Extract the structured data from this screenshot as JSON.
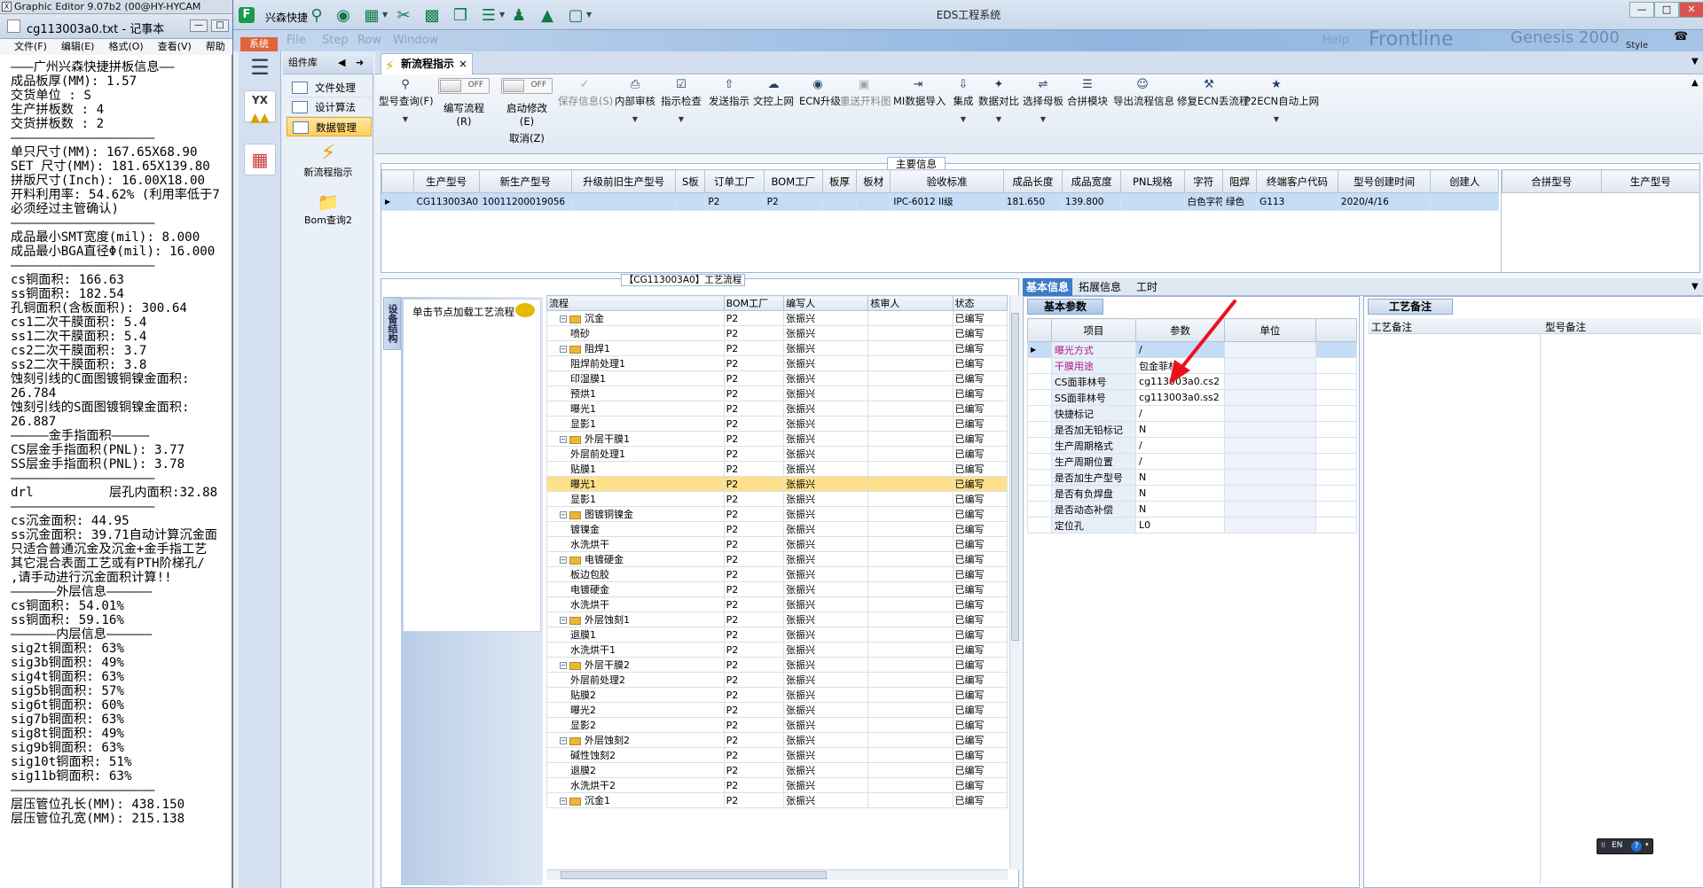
{
  "ge_window": {
    "title": "Graphic Editor 9.07b2 (00@HY-HYCAM"
  },
  "notepad": {
    "title": "cg113003a0.txt - 记事本",
    "menu": [
      "文件(F)",
      "编辑(E)",
      "格式(O)",
      "查看(V)",
      "帮助"
    ],
    "lines": [
      "———广州兴森快捷拼板信息——",
      "成品板厚(MM): 1.57",
      "交货单位 : S",
      "生产拼板数 : 4",
      "交货拼板数 : 2",
      "———————————————————",
      "单只尺寸(MM): 167.65X68.90",
      "SET 尺寸(MM): 181.65X139.80",
      "拼版尺寸(Inch): 16.00X18.00",
      "开料利用率: 54.62% (利用率低于7",
      "必须经过主管确认)",
      "———————————————————",
      "成品最小SMT宽度(mil): 8.000",
      "成品最小BGA直径Φ(mil): 16.000",
      "———————————————————",
      "cs铜面积: 166.63",
      "ss铜面积: 182.54",
      "孔铜面积(含板面积): 300.64",
      "",
      "cs1二次干膜面积: 5.4",
      "ss1二次干膜面积: 5.4",
      "cs2二次干膜面积: 3.7",
      "ss2二次干膜面积: 3.8",
      "蚀刻引线的C面图镀铜镍金面积:",
      "26.784",
      "蚀刻引线的S面图镀铜镍金面积:",
      "26.887",
      "—————金手指面积—————",
      "CS层金手指面积(PNL): 3.77",
      "SS层金手指面积(PNL): 3.78",
      "———————————————————",
      "drl          层孔内面积:32.88",
      "———————————————————",
      "",
      "cs沉金面积: 44.95",
      "ss沉金面积: 39.71自动计算沉金面",
      "只适合普通沉金及沉金+金手指工艺",
      "其它混合表面工艺或有PTH阶梯孔/",
      ",请手动进行沉金面积计算!!",
      "——————外层信息——————",
      "cs铜面积: 54.01%",
      "ss铜面积: 59.16%",
      "——————内层信息——————",
      "sig2t铜面积: 63%",
      "sig3b铜面积: 49%",
      "sig4t铜面积: 63%",
      "sig5b铜面积: 57%",
      "sig6t铜面积: 60%",
      "sig7b铜面积: 63%",
      "sig8t铜面积: 49%",
      "sig9b铜面积: 63%",
      "sig10t铜面积: 51%",
      "sig11b铜面积: 63%",
      "———————————————————",
      "层压管位孔长(MM): 438.150",
      "层压管位孔宽(MM): 215.138"
    ]
  },
  "app": {
    "title": "EDS工程系统",
    "quick_label": "兴森快捷",
    "system_tab": "系统",
    "style_label": "Style",
    "blur_text": [
      "File",
      "Step",
      "Row",
      "Window",
      "Help",
      "Frontline",
      "Genesis 2000"
    ],
    "window_buttons": [
      "—",
      "□",
      "✕"
    ]
  },
  "component_lib": {
    "title": "组件库",
    "items": [
      "文件处理",
      "设计算法",
      "数据管理"
    ],
    "big_items": [
      "新流程指示",
      "Bom查询2"
    ]
  },
  "doc_tab": {
    "label": "新流程指示",
    "close": "×"
  },
  "ribbon": {
    "buttons": [
      {
        "label": "型号查询(F)",
        "icon": "magnifier-icon",
        "dropdown": true
      },
      {
        "label": "保存信息(S)",
        "icon": "check-icon",
        "disabled": true
      },
      {
        "label": "内部审核",
        "icon": "printer-icon",
        "dropdown": true
      },
      {
        "label": "指示检查",
        "icon": "checkbox-icon",
        "dropdown": true
      },
      {
        "label": "发送指示",
        "icon": "upload-icon"
      },
      {
        "label": "文控上网",
        "icon": "cloud-icon"
      },
      {
        "label": "ECN升级",
        "icon": "binoculars-icon"
      },
      {
        "label": "重送开料图",
        "icon": "picture-icon",
        "disabled": true
      },
      {
        "label": "MI数据导入",
        "icon": "import-icon"
      },
      {
        "label": "集成",
        "icon": "download-icon",
        "dropdown": true
      },
      {
        "label": "数据对比",
        "icon": "wand-icon",
        "dropdown": true
      },
      {
        "label": "选择母板",
        "icon": "shuffle-icon",
        "dropdown": true
      },
      {
        "label": "合拼模块",
        "icon": "list-icon"
      },
      {
        "label": "导出流程信息",
        "icon": "smile-icon"
      },
      {
        "label": "修复ECN丢流程",
        "icon": "wrench-icon"
      },
      {
        "label": "P2ECN自动上网",
        "icon": "star-icon",
        "dropdown": true
      }
    ],
    "toggle1": {
      "label": "编写流程(R)",
      "state": "OFF"
    },
    "toggle2": {
      "label": "启动修改(E)",
      "state": "OFF",
      "sub": "取消(Z)"
    }
  },
  "main_info": {
    "title": "主要信息",
    "columns": [
      "生产型号",
      "新生产型号",
      "升级前旧生产型号",
      "S板",
      "订单工厂",
      "BOM工厂",
      "板厚",
      "板材",
      "验收标准",
      "成品长度",
      "成品宽度",
      "PNL规格",
      "字符",
      "阻焊",
      "终端客户代码",
      "型号创建时间",
      "创建人"
    ],
    "row": [
      "CG113003A0",
      "10011200019056",
      "",
      "",
      "P2",
      "P2",
      "",
      "",
      "IPC-6012 II级",
      "181.650",
      "139.800",
      "",
      "白色字符",
      "绿色",
      "G113",
      "2020/4/16",
      ""
    ],
    "side_columns": [
      "合拼型号",
      "生产型号"
    ]
  },
  "flow": {
    "title": "【CG113003A0】工艺流程",
    "vtab": "设备结构",
    "hint": "单击节点加载工艺流程",
    "columns": [
      "流程",
      "BOM工厂",
      "编写人",
      "核审人",
      "状态"
    ],
    "rows": [
      {
        "name": "沉金",
        "level": 0,
        "factory": "P2",
        "writer": "张振兴",
        "status": "已编写"
      },
      {
        "name": "喷砂",
        "level": 1,
        "factory": "P2",
        "writer": "张振兴",
        "status": "已编写"
      },
      {
        "name": "阻焊1",
        "level": 0,
        "factory": "P2",
        "writer": "张振兴",
        "status": "已编写"
      },
      {
        "name": "阻焊前处理1",
        "level": 1,
        "factory": "P2",
        "writer": "张振兴",
        "status": "已编写"
      },
      {
        "name": "印湿膜1",
        "level": 1,
        "factory": "P2",
        "writer": "张振兴",
        "status": "已编写"
      },
      {
        "name": "预烘1",
        "level": 1,
        "factory": "P2",
        "writer": "张振兴",
        "status": "已编写"
      },
      {
        "name": "曝光1",
        "level": 1,
        "factory": "P2",
        "writer": "张振兴",
        "status": "已编写"
      },
      {
        "name": "显影1",
        "level": 1,
        "factory": "P2",
        "writer": "张振兴",
        "status": "已编写"
      },
      {
        "name": "外层干膜1",
        "level": 0,
        "factory": "P2",
        "writer": "张振兴",
        "status": "已编写"
      },
      {
        "name": "外层前处理1",
        "level": 1,
        "factory": "P2",
        "writer": "张振兴",
        "status": "已编写"
      },
      {
        "name": "贴膜1",
        "level": 1,
        "factory": "P2",
        "writer": "张振兴",
        "status": "已编写"
      },
      {
        "name": "曝光1",
        "level": 1,
        "factory": "P2",
        "writer": "张振兴",
        "status": "已编写",
        "selected": true
      },
      {
        "name": "显影1",
        "level": 1,
        "factory": "P2",
        "writer": "张振兴",
        "status": "已编写"
      },
      {
        "name": "图镀铜镍金",
        "level": 0,
        "factory": "P2",
        "writer": "张振兴",
        "status": "已编写"
      },
      {
        "name": "镀镍金",
        "level": 1,
        "factory": "P2",
        "writer": "张振兴",
        "status": "已编写"
      },
      {
        "name": "水洗烘干",
        "level": 1,
        "factory": "P2",
        "writer": "张振兴",
        "status": "已编写"
      },
      {
        "name": "电镀硬金",
        "level": 0,
        "factory": "P2",
        "writer": "张振兴",
        "status": "已编写"
      },
      {
        "name": "板边包胶",
        "level": 1,
        "factory": "P2",
        "writer": "张振兴",
        "status": "已编写"
      },
      {
        "name": "电镀硬金",
        "level": 1,
        "factory": "P2",
        "writer": "张振兴",
        "status": "已编写"
      },
      {
        "name": "水洗烘干",
        "level": 1,
        "factory": "P2",
        "writer": "张振兴",
        "status": "已编写"
      },
      {
        "name": "外层蚀刻1",
        "level": 0,
        "factory": "P2",
        "writer": "张振兴",
        "status": "已编写"
      },
      {
        "name": "退膜1",
        "level": 1,
        "factory": "P2",
        "writer": "张振兴",
        "status": "已编写"
      },
      {
        "name": "水洗烘干1",
        "level": 1,
        "factory": "P2",
        "writer": "张振兴",
        "status": "已编写"
      },
      {
        "name": "外层干膜2",
        "level": 0,
        "factory": "P2",
        "writer": "张振兴",
        "status": "已编写"
      },
      {
        "name": "外层前处理2",
        "level": 1,
        "factory": "P2",
        "writer": "张振兴",
        "status": "已编写"
      },
      {
        "name": "贴膜2",
        "level": 1,
        "factory": "P2",
        "writer": "张振兴",
        "status": "已编写"
      },
      {
        "name": "曝光2",
        "level": 1,
        "factory": "P2",
        "writer": "张振兴",
        "status": "已编写"
      },
      {
        "name": "显影2",
        "level": 1,
        "factory": "P2",
        "writer": "张振兴",
        "status": "已编写"
      },
      {
        "name": "外层蚀刻2",
        "level": 0,
        "factory": "P2",
        "writer": "张振兴",
        "status": "已编写"
      },
      {
        "name": "碱性蚀刻2",
        "level": 1,
        "factory": "P2",
        "writer": "张振兴",
        "status": "已编写"
      },
      {
        "name": "退膜2",
        "level": 1,
        "factory": "P2",
        "writer": "张振兴",
        "status": "已编写"
      },
      {
        "name": "水洗烘干2",
        "level": 1,
        "factory": "P2",
        "writer": "张振兴",
        "status": "已编写"
      },
      {
        "name": "沉金1",
        "level": 0,
        "factory": "P2",
        "writer": "张振兴",
        "status": "已编写"
      }
    ]
  },
  "info_tabs": [
    "基本信息",
    "拓展信息",
    "工时"
  ],
  "basic_params": {
    "tab": "基本参数",
    "columns": [
      "项目",
      "参数",
      "单位"
    ],
    "rows": [
      {
        "item": "曝光方式",
        "value": "/",
        "pink": true
      },
      {
        "item": "干膜用途",
        "value": "包金菲林",
        "pink": true
      },
      {
        "item": "CS面菲林号",
        "value": "cg113003a0.cs2"
      },
      {
        "item": "SS面菲林号",
        "value": "cg113003a0.ss2"
      },
      {
        "item": "快捷标记",
        "value": "/"
      },
      {
        "item": "是否加无铅标记",
        "value": "N"
      },
      {
        "item": "生产周期格式",
        "value": "/"
      },
      {
        "item": "生产周期位置",
        "value": "/"
      },
      {
        "item": "是否加生产型号",
        "value": "N"
      },
      {
        "item": "是否有负焊盘",
        "value": "N"
      },
      {
        "item": "是否动态补偿",
        "value": "N"
      },
      {
        "item": "定位孔",
        "value": "L0"
      }
    ]
  },
  "remarks": {
    "tab": "工艺备注",
    "columns": [
      "工艺备注",
      "型号备注"
    ]
  },
  "ime": {
    "label": "EN"
  },
  "colors": {
    "accent": "#3b7bc8",
    "highlight": "#ffe08a",
    "selected_row": "#c5dcf6",
    "arrow": "#e8121d",
    "pink_text": "#b0168c"
  }
}
